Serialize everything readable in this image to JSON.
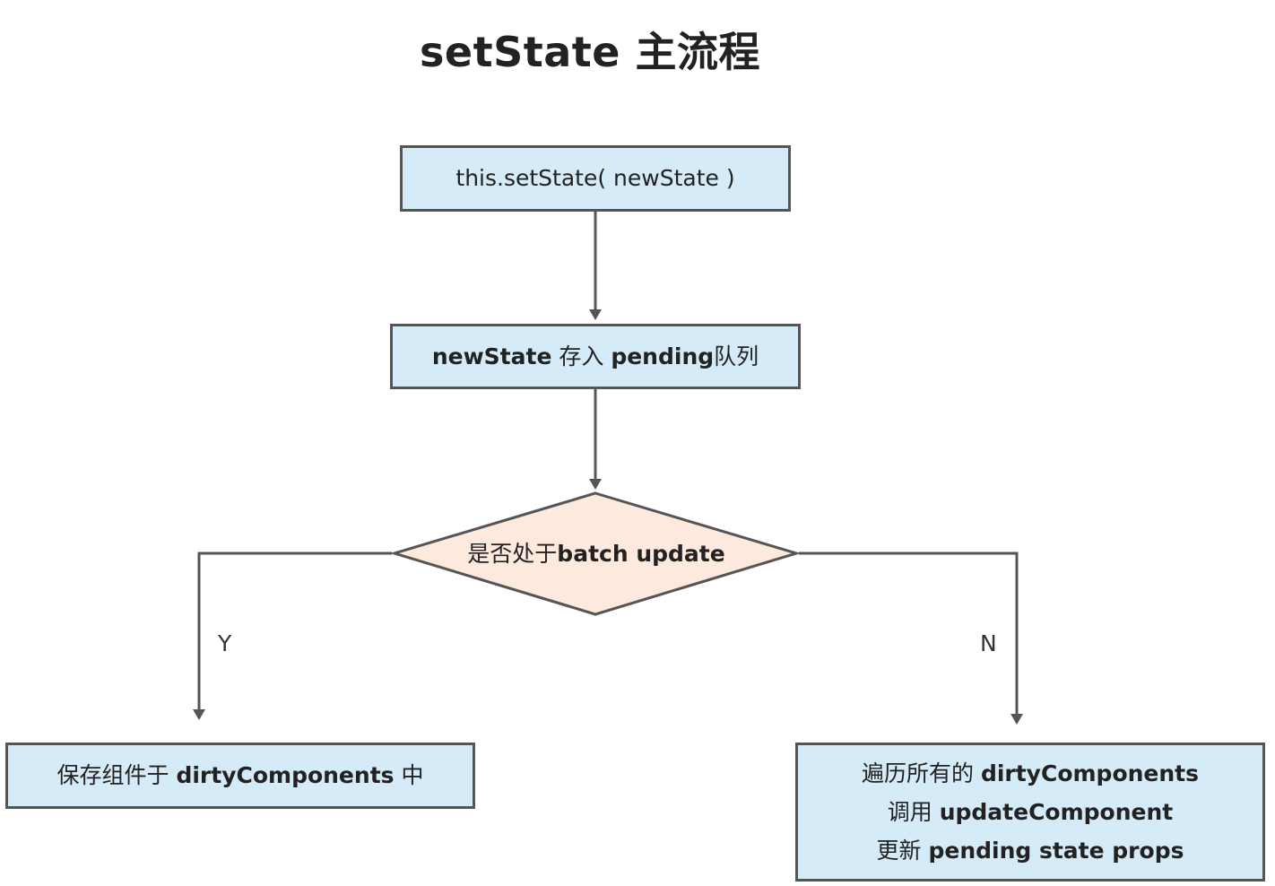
{
  "title": "setState 主流程",
  "nodes": {
    "start": {
      "text": "this.setState( newState )"
    },
    "enqueue": {
      "bold1": "newState",
      "text1": " 存入 ",
      "bold2": "pending",
      "text2": "队列"
    },
    "decision": {
      "text": "是否处于",
      "bold": "batch update"
    },
    "yes_box": {
      "text1": "保存组件于 ",
      "bold": "dirtyComponents",
      "text2": " 中"
    },
    "no_box": {
      "line1_text": "遍历所有的 ",
      "line1_bold": "dirtyComponents",
      "line2_text": "调用 ",
      "line2_bold": "updateComponent",
      "line3_text": "更新 ",
      "line3_bold": "pending state props"
    }
  },
  "branches": {
    "yes": "Y",
    "no": "N"
  },
  "colors": {
    "box_fill": "#d6ebf8",
    "decision_fill": "#fde9de",
    "stroke": "#555555"
  }
}
